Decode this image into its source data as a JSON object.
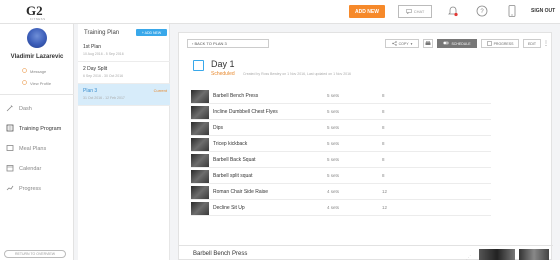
{
  "topbar": {
    "logo": "G2",
    "logo_sub": "FITNESS",
    "add_new_label": "ADD NEW",
    "chat_label": "CHAT",
    "sign_out_label": "SIGN OUT"
  },
  "sidebar": {
    "user_name": "Vladimir Lazarevic",
    "message_label": "Message",
    "view_profile_label": "View Profile",
    "nav": [
      {
        "label": "Dash"
      },
      {
        "label": "Training Program"
      },
      {
        "label": "Meal Plans"
      },
      {
        "label": "Calendar"
      },
      {
        "label": "Progress"
      }
    ],
    "return_label": "RETURN TO OVERVIEW"
  },
  "plans": {
    "title": "Training Plan",
    "add_new_label": "+ ADD NEW",
    "items": [
      {
        "name": "1st Plan",
        "dates": "10 Aug 2016 - 5 Sep 2016"
      },
      {
        "name": "2 Day Split",
        "dates": "6 Sep 2016 - 30 Oct 2016"
      },
      {
        "name": "Plan 3",
        "dates": "31 Oct 2016 - 12 Feb 2017",
        "badge": "Current"
      }
    ]
  },
  "main": {
    "back_label": "‹ BACK TO PLAN 3",
    "copy_label": "COPY",
    "schedule_label": "SCHEDULE",
    "progress_label": "PROGRESS",
    "edit_label": "EDIT",
    "day_title": "Day 1",
    "day_status": "Scheduled",
    "day_meta": "Created by Ross Bewley on 1 Nov 2016, Last updated on 1 Nov 2016",
    "exercises": [
      {
        "name": "Barbell Bench Press",
        "sets": "5 sets",
        "reps": "8"
      },
      {
        "name": "Incline Dumbbell Chest Flyes",
        "sets": "5 sets",
        "reps": "8"
      },
      {
        "name": "Dips",
        "sets": "5 sets",
        "reps": "8"
      },
      {
        "name": "Tricep kickback",
        "sets": "5 sets",
        "reps": "8"
      },
      {
        "name": "Barbell Back Squat",
        "sets": "5 sets",
        "reps": "8"
      },
      {
        "name": "Barbell split squat",
        "sets": "5 sets",
        "reps": "8"
      },
      {
        "name": "Roman Chair Side Raise",
        "sets": "4 sets",
        "reps": "12"
      },
      {
        "name": "Decline Sit Up",
        "sets": "4 sets",
        "reps": "12"
      }
    ],
    "bottom_title": "Barbell Bench Press"
  },
  "colors": {
    "accent_orange": "#f6892a",
    "accent_blue": "#39a8ea",
    "active_plan_bg": "#d7ecfa"
  }
}
